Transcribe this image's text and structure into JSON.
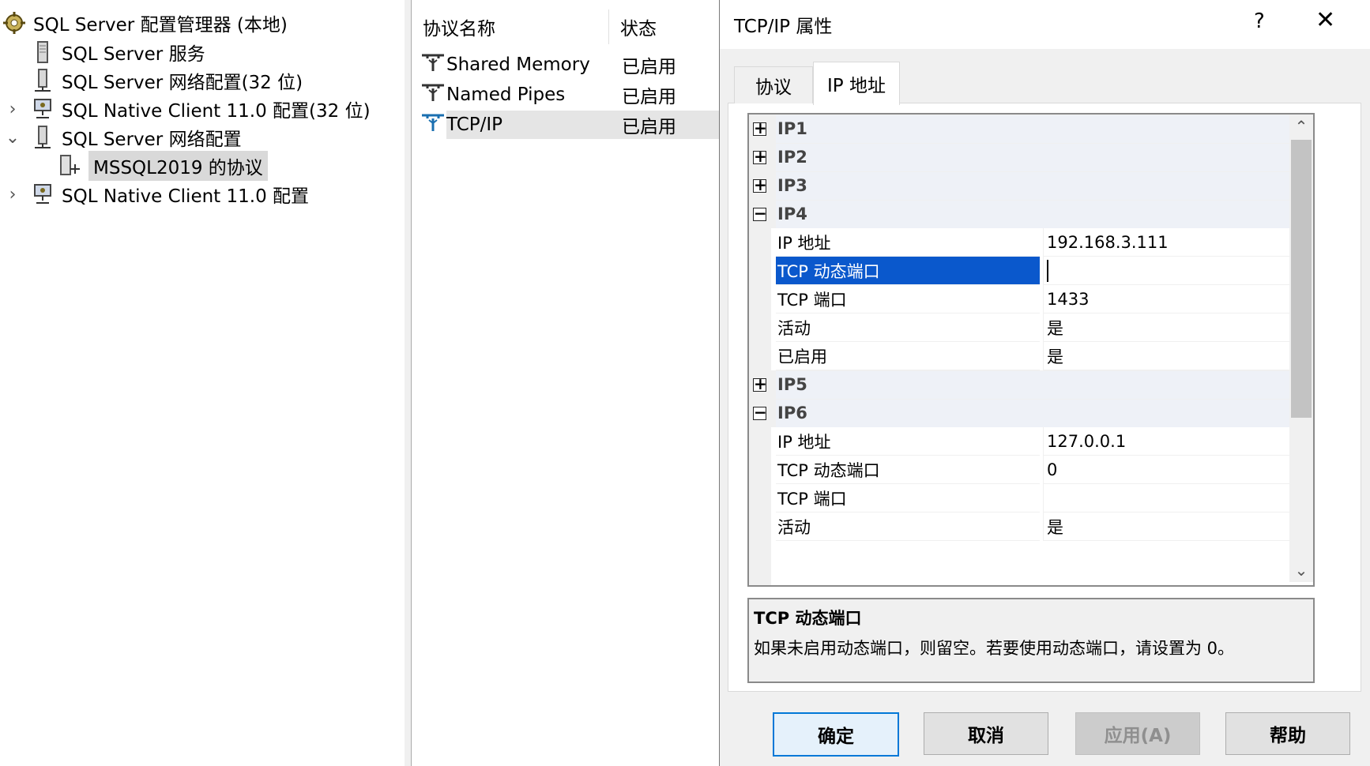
{
  "tree": {
    "items": [
      {
        "label": "SQL Server 配置管理器 (本地)",
        "icon": "config-manager-icon"
      },
      {
        "label": "SQL Server 服务",
        "icon": "server-services-icon"
      },
      {
        "label": "SQL Server 网络配置(32 位)",
        "icon": "network-config-icon"
      },
      {
        "label": "SQL Native Client 11.0 配置(32 位)",
        "icon": "native-client-icon",
        "expander": "collapsed"
      },
      {
        "label": "SQL Server 网络配置",
        "icon": "network-config-icon",
        "expander": "expanded"
      },
      {
        "label": "MSSQL2019 的协议",
        "icon": "protocols-icon",
        "selected": true
      },
      {
        "label": "SQL Native Client 11.0 配置",
        "icon": "native-client-icon",
        "expander": "collapsed"
      }
    ]
  },
  "list": {
    "columns": [
      "协议名称",
      "状态"
    ],
    "rows": [
      {
        "name": "Shared Memory",
        "status": "已启用"
      },
      {
        "name": "Named Pipes",
        "status": "已启用"
      },
      {
        "name": "TCP/IP",
        "status": "已启用",
        "selected": true
      }
    ]
  },
  "dialog": {
    "title": "TCP/IP 属性",
    "help": "?",
    "close": "✕",
    "tabs": [
      "协议",
      "IP 地址"
    ],
    "active_tab": "IP 地址",
    "grid": {
      "rows": [
        {
          "type": "category",
          "name": "IP1",
          "expander": "+"
        },
        {
          "type": "category",
          "name": "IP2",
          "expander": "+"
        },
        {
          "type": "category",
          "name": "IP3",
          "expander": "+"
        },
        {
          "type": "category",
          "name": "IP4",
          "expander": "−"
        },
        {
          "type": "prop",
          "name": "IP 地址",
          "value": "192.168.3.111"
        },
        {
          "type": "prop",
          "name": "TCP 动态端口",
          "value": "",
          "selected": true
        },
        {
          "type": "prop",
          "name": "TCP 端口",
          "value": "1433"
        },
        {
          "type": "prop",
          "name": "活动",
          "value": "是"
        },
        {
          "type": "prop",
          "name": "已启用",
          "value": "是"
        },
        {
          "type": "category",
          "name": "IP5",
          "expander": "+"
        },
        {
          "type": "category",
          "name": "IP6",
          "expander": "−"
        },
        {
          "type": "prop",
          "name": "IP 地址",
          "value": "127.0.0.1"
        },
        {
          "type": "prop",
          "name": "TCP 动态端口",
          "value": "0"
        },
        {
          "type": "prop",
          "name": "TCP 端口",
          "value": ""
        },
        {
          "type": "prop",
          "name": "活动",
          "value": "是"
        }
      ]
    },
    "description": {
      "title": "TCP 动态端口",
      "text": "如果未启用动态端口，则留空。若要使用动态端口，请设置为 0。"
    },
    "buttons": {
      "ok": "确定",
      "cancel": "取消",
      "apply": "应用(A)",
      "help": "帮助"
    }
  },
  "colors": {
    "selection": "#0a58cc",
    "category_bg": "#eef1f7",
    "ok_border": "#0078d7"
  }
}
